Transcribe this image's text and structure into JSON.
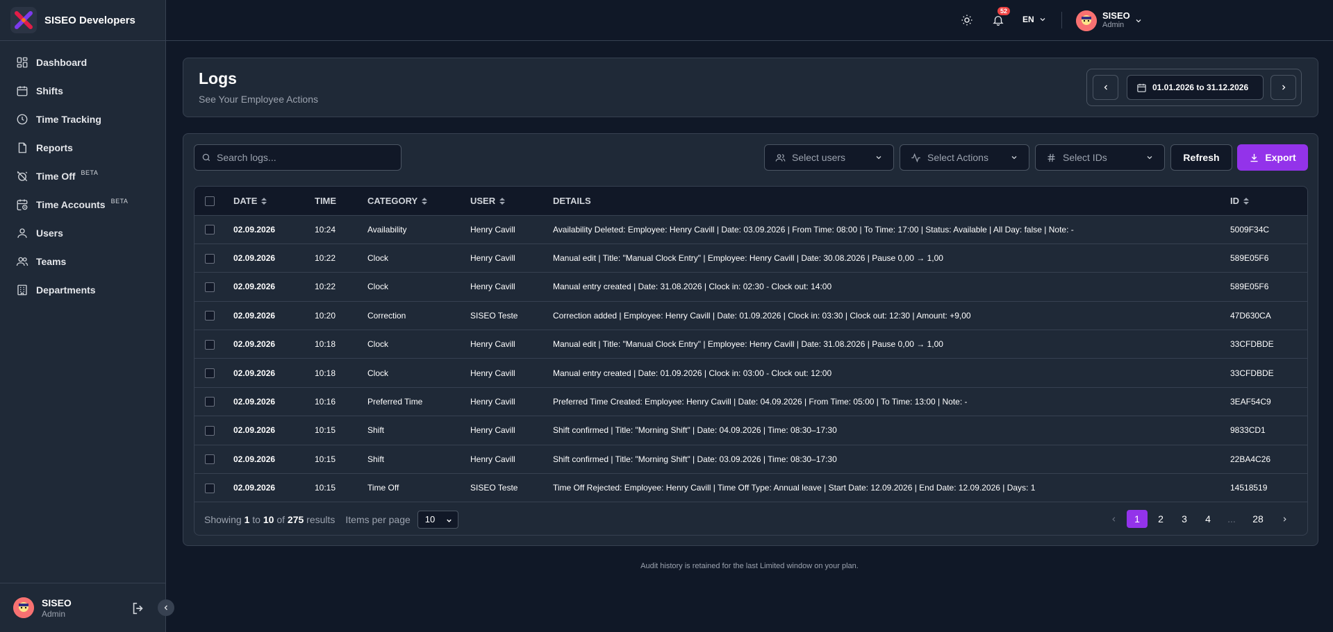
{
  "brand": {
    "name": "SISEO Developers"
  },
  "sidebar": {
    "items": [
      {
        "label": "Dashboard",
        "icon": "dashboard-icon",
        "beta": ""
      },
      {
        "label": "Shifts",
        "icon": "calendar-icon",
        "beta": ""
      },
      {
        "label": "Time Tracking",
        "icon": "clock-icon",
        "beta": ""
      },
      {
        "label": "Reports",
        "icon": "file-icon",
        "beta": ""
      },
      {
        "label": "Time Off",
        "icon": "alarm-off-icon",
        "beta": "BETA"
      },
      {
        "label": "Time Accounts",
        "icon": "calendar-clock-icon",
        "beta": "BETA"
      },
      {
        "label": "Users",
        "icon": "user-icon",
        "beta": ""
      },
      {
        "label": "Teams",
        "icon": "users-icon",
        "beta": ""
      },
      {
        "label": "Departments",
        "icon": "building-icon",
        "beta": ""
      }
    ],
    "footer": {
      "name": "SISEO",
      "role": "Admin"
    }
  },
  "topbar": {
    "notifications": "52",
    "language": "EN",
    "user": {
      "name": "SISEO",
      "role": "Admin"
    }
  },
  "header": {
    "title": "Logs",
    "subtitle": "See Your Employee Actions",
    "date_range": "01.01.2026 to 31.12.2026"
  },
  "filters": {
    "search_placeholder": "Search logs...",
    "users": "Select users",
    "actions": "Select Actions",
    "ids": "Select IDs",
    "refresh": "Refresh",
    "export": "Export"
  },
  "table": {
    "headers": {
      "date": "DATE",
      "time": "TIME",
      "category": "CATEGORY",
      "user": "USER",
      "details": "DETAILS",
      "id": "ID"
    },
    "rows": [
      {
        "date": "02.09.2026",
        "time": "10:24",
        "category": "Availability",
        "user": "Henry Cavill",
        "details": "Availability Deleted: Employee: Henry Cavill | Date: 03.09.2026 | From Time: 08:00 | To Time: 17:00 | Status: Available | All Day: false | Note: -",
        "id": "5009F34C"
      },
      {
        "date": "02.09.2026",
        "time": "10:22",
        "category": "Clock",
        "user": "Henry Cavill",
        "details": "Manual edit | Title: \"Manual Clock Entry\" | Employee: Henry Cavill | Date: 30.08.2026 | Pause 0,00 → 1,00",
        "id": "589E05F6"
      },
      {
        "date": "02.09.2026",
        "time": "10:22",
        "category": "Clock",
        "user": "Henry Cavill",
        "details": "Manual entry created | Date: 31.08.2026 | Clock in: 02:30 - Clock out: 14:00",
        "id": "589E05F6"
      },
      {
        "date": "02.09.2026",
        "time": "10:20",
        "category": "Correction",
        "user": "SISEO Teste",
        "details": "Correction added | Employee: Henry Cavill | Date: 01.09.2026 | Clock in: 03:30 | Clock out: 12:30 | Amount: +9,00",
        "id": "47D630CA"
      },
      {
        "date": "02.09.2026",
        "time": "10:18",
        "category": "Clock",
        "user": "Henry Cavill",
        "details": "Manual edit | Title: \"Manual Clock Entry\" | Employee: Henry Cavill | Date: 31.08.2026 | Pause 0,00 → 1,00",
        "id": "33CFDBDE"
      },
      {
        "date": "02.09.2026",
        "time": "10:18",
        "category": "Clock",
        "user": "Henry Cavill",
        "details": "Manual entry created | Date: 01.09.2026 | Clock in: 03:00 - Clock out: 12:00",
        "id": "33CFDBDE"
      },
      {
        "date": "02.09.2026",
        "time": "10:16",
        "category": "Preferred Time",
        "user": "Henry Cavill",
        "details": "Preferred Time Created: Employee: Henry Cavill | Date: 04.09.2026 | From Time: 05:00 | To Time: 13:00 | Note: -",
        "id": "3EAF54C9"
      },
      {
        "date": "02.09.2026",
        "time": "10:15",
        "category": "Shift",
        "user": "Henry Cavill",
        "details": "Shift confirmed | Title: \"Morning Shift\" | Date: 04.09.2026 | Time: 08:30–17:30",
        "id": "9833CD1"
      },
      {
        "date": "02.09.2026",
        "time": "10:15",
        "category": "Shift",
        "user": "Henry Cavill",
        "details": "Shift confirmed | Title: \"Morning Shift\" | Date: 03.09.2026 | Time: 08:30–17:30",
        "id": "22BA4C26"
      },
      {
        "date": "02.09.2026",
        "time": "10:15",
        "category": "Time Off",
        "user": "SISEO Teste",
        "details": "Time Off Rejected: Employee: Henry Cavill | Time Off Type: Annual leave | Start Date: 12.09.2026 | End Date: 12.09.2026 | Days: 1",
        "id": "14518519"
      }
    ]
  },
  "pagination": {
    "showing": "Showing",
    "from": "1",
    "to_word": "to",
    "to": "10",
    "of_word": "of",
    "total": "275",
    "results_word": "results",
    "items_per_page_label": "Items per page",
    "items_per_page": "10",
    "pages": [
      "1",
      "2",
      "3",
      "4",
      "...",
      "28"
    ],
    "current": "1"
  },
  "retention_note": "Audit history is retained for the last Limited window on your plan.",
  "colors": {
    "accent": "#9333ea",
    "badge": "#ef4444",
    "background": "#101827",
    "panel": "#1f2937"
  }
}
